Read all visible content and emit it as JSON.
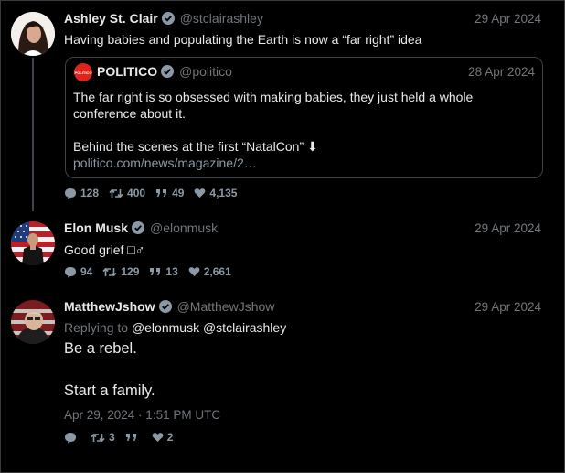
{
  "tweets": [
    {
      "name": "Ashley St. Clair",
      "handle": "@stclairashley",
      "date": "29 Apr 2024",
      "text": "Having babies and populating the Earth is now a “far right” idea",
      "quote": {
        "logo_text": "POLITICO",
        "name": "POLITICO",
        "handle": "@politico",
        "date": "28 Apr 2024",
        "line1": "The far right is so obsessed with making babies, they just held a whole",
        "line2": "conference about it.",
        "line3": "Behind the scenes at the first “NatalCon” ⬇",
        "link": "politico.com/news/magazine/2…"
      },
      "stats": {
        "replies": "128",
        "retweets": "400",
        "quotes": "49",
        "likes": "4,135"
      }
    },
    {
      "name": "Elon Musk",
      "handle": "@elonmusk",
      "date": "29 Apr 2024",
      "text": "Good grief □♂",
      "stats": {
        "replies": "94",
        "retweets": "129",
        "quotes": "13",
        "likes": "2,661"
      }
    },
    {
      "name": "MatthewJshow",
      "handle": "@MatthewJshow",
      "date": "29 Apr 2024",
      "replying_prefix": "Replying to",
      "replying_to_1": "@elonmusk",
      "replying_to_2": "@stclairashley",
      "line1": "Be a rebel.",
      "line2": "Start a family.",
      "timestamp": "Apr 29, 2024 · 1:51 PM UTC",
      "stats": {
        "replies": "",
        "retweets": "3",
        "quotes": "",
        "likes": "2"
      }
    }
  ],
  "colors": {
    "background": "#000000",
    "text": "#e7e9ea",
    "muted": "#71767b",
    "verified": "#1d9bf0",
    "politico_red": "#e0241b"
  },
  "icons": [
    "verified-badge-icon",
    "reply-icon",
    "retweet-icon",
    "quote-icon",
    "heart-icon",
    "politico-logo"
  ]
}
